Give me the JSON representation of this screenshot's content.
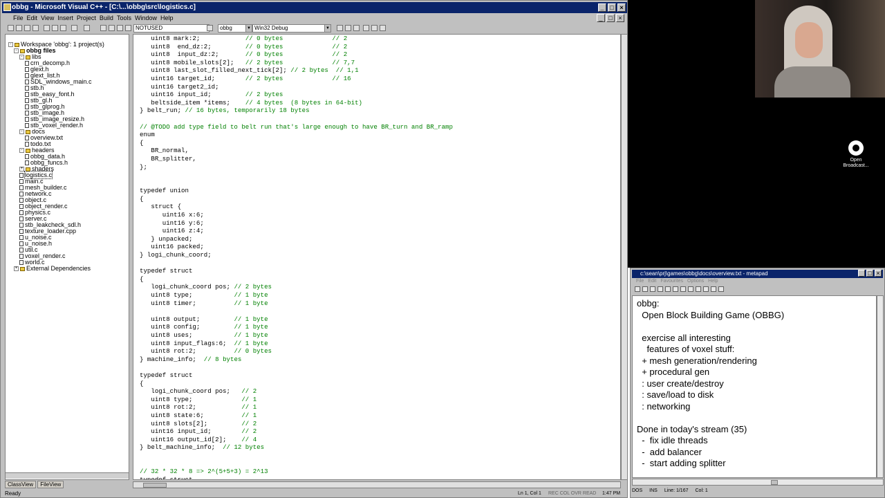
{
  "vc": {
    "title": "obbg - Microsoft Visual C++ - [C:\\...\\obbg\\src\\logistics.c]",
    "menu": [
      "File",
      "Edit",
      "View",
      "Insert",
      "Project",
      "Build",
      "Tools",
      "Window",
      "Help"
    ],
    "toolbar": {
      "config": "NOTUSED",
      "project": "obbg",
      "build": "Win32 Debug"
    },
    "workspace": {
      "title": "Workspace 'obbg': 1 project(s)",
      "items": [
        {
          "t": "obbg files",
          "i": "folder",
          "d": 1,
          "bold": true
        },
        {
          "t": "libs",
          "i": "folder",
          "d": 2
        },
        {
          "t": "crn_decomp.h",
          "i": "doc",
          "d": 3
        },
        {
          "t": "glext.h",
          "i": "doc",
          "d": 3
        },
        {
          "t": "glext_list.h",
          "i": "doc",
          "d": 3
        },
        {
          "t": "SDL_windows_main.c",
          "i": "doc",
          "d": 3
        },
        {
          "t": "stb.h",
          "i": "doc",
          "d": 3
        },
        {
          "t": "stb_easy_font.h",
          "i": "doc",
          "d": 3
        },
        {
          "t": "stb_gl.h",
          "i": "doc",
          "d": 3
        },
        {
          "t": "stb_glprog.h",
          "i": "doc",
          "d": 3
        },
        {
          "t": "stb_image.h",
          "i": "doc",
          "d": 3
        },
        {
          "t": "stb_image_resize.h",
          "i": "doc",
          "d": 3
        },
        {
          "t": "stb_voxel_render.h",
          "i": "doc",
          "d": 3
        },
        {
          "t": "docs",
          "i": "folder",
          "d": 2
        },
        {
          "t": "overview.txt",
          "i": "doc",
          "d": 3
        },
        {
          "t": "todo.txt",
          "i": "doc",
          "d": 3
        },
        {
          "t": "headers",
          "i": "folder",
          "d": 2
        },
        {
          "t": "obbg_data.h",
          "i": "doc",
          "d": 3
        },
        {
          "t": "obbg_funcs.h",
          "i": "doc",
          "d": 3
        },
        {
          "t": "shaders",
          "i": "folder",
          "d": 2
        },
        {
          "t": "logistics.c",
          "i": "doc",
          "d": 2,
          "sel": true
        },
        {
          "t": "main.c",
          "i": "doc",
          "d": 2
        },
        {
          "t": "mesh_builder.c",
          "i": "doc",
          "d": 2
        },
        {
          "t": "network.c",
          "i": "doc",
          "d": 2
        },
        {
          "t": "object.c",
          "i": "doc",
          "d": 2
        },
        {
          "t": "object_render.c",
          "i": "doc",
          "d": 2
        },
        {
          "t": "physics.c",
          "i": "doc",
          "d": 2
        },
        {
          "t": "server.c",
          "i": "doc",
          "d": 2
        },
        {
          "t": "stb_leakcheck_sdl.h",
          "i": "doc",
          "d": 2
        },
        {
          "t": "texture_loader.cpp",
          "i": "doc",
          "d": 2
        },
        {
          "t": "u_noise.c",
          "i": "doc",
          "d": 2
        },
        {
          "t": "u_noise.h",
          "i": "doc",
          "d": 2
        },
        {
          "t": "util.c",
          "i": "doc",
          "d": 2
        },
        {
          "t": "voxel_render.c",
          "i": "doc",
          "d": 2
        },
        {
          "t": "world.c",
          "i": "doc",
          "d": 2
        },
        {
          "t": "External Dependencies",
          "i": "folder",
          "d": 1
        }
      ]
    },
    "tabs": [
      "ClassView",
      "FileView"
    ],
    "code": [
      [
        "   uint8 mark:2;            ",
        "// 0 bytes             // 2"
      ],
      [
        "   uint8  end_dz:2;         ",
        "// 0 bytes             // 2"
      ],
      [
        "   uint8  input_dz:2;       ",
        "// 0 bytes             // 2"
      ],
      [
        "   uint8 mobile_slots[2];   ",
        "// 2 bytes             // 7,7"
      ],
      [
        "   uint8 last_slot_filled_next_tick[2]; ",
        "// 2 bytes  // 1,1"
      ],
      [
        "   uint16 target_id;        ",
        "// 2 bytes             // 16"
      ],
      [
        "   uint16 target2_id;",
        ""
      ],
      [
        "   uint16 input_id;         ",
        "// 2 bytes"
      ],
      [
        "   beltside_item *items;    ",
        "// 4 bytes  (8 bytes in 64-bit)"
      ],
      [
        "} belt_run; ",
        "// 16 bytes, temporarily 18 bytes"
      ],
      [
        "",
        ""
      ],
      [
        "",
        "// @TODO add type field to belt run that's large enough to have BR_turn and BR_ramp"
      ],
      [
        "enum",
        ""
      ],
      [
        "{",
        ""
      ],
      [
        "   BR_normal,",
        ""
      ],
      [
        "   BR_splitter,",
        ""
      ],
      [
        "};",
        ""
      ],
      [
        "",
        ""
      ],
      [
        "",
        ""
      ],
      [
        "typedef union",
        ""
      ],
      [
        "{",
        ""
      ],
      [
        "   struct {",
        ""
      ],
      [
        "      uint16 x:6;",
        ""
      ],
      [
        "      uint16 y:6;",
        ""
      ],
      [
        "      uint16 z:4;",
        ""
      ],
      [
        "   } unpacked;",
        ""
      ],
      [
        "   uint16 packed;",
        ""
      ],
      [
        "} logi_chunk_coord;",
        ""
      ],
      [
        "",
        ""
      ],
      [
        "typedef struct",
        ""
      ],
      [
        "{",
        ""
      ],
      [
        "   logi_chunk_coord pos; ",
        "// 2 bytes"
      ],
      [
        "   uint8 type;           ",
        "// 1 byte"
      ],
      [
        "   uint8 timer;          ",
        "// 1 byte"
      ],
      [
        "",
        ""
      ],
      [
        "   uint8 output;         ",
        "// 1 byte"
      ],
      [
        "   uint8 config;         ",
        "// 1 byte"
      ],
      [
        "   uint8 uses;           ",
        "// 1 byte"
      ],
      [
        "   uint8 input_flags:6;  ",
        "// 1 byte"
      ],
      [
        "   uint8 rot:2;          ",
        "// 0 bytes"
      ],
      [
        "} machine_info;  ",
        "// 8 bytes"
      ],
      [
        "",
        ""
      ],
      [
        "typedef struct",
        ""
      ],
      [
        "{",
        ""
      ],
      [
        "   logi_chunk_coord pos;   ",
        "// 2"
      ],
      [
        "   uint8 type;             ",
        "// 1"
      ],
      [
        "   uint8 rot:2;            ",
        "// 1"
      ],
      [
        "   uint8 state:6;          ",
        "// 1"
      ],
      [
        "   uint8 slots[2];         ",
        "// 2"
      ],
      [
        "   uint16 input_id;        ",
        "// 2"
      ],
      [
        "   uint16 output_id[2];    ",
        "// 4"
      ],
      [
        "} belt_machine_info;  ",
        "// 12 bytes"
      ],
      [
        "",
        ""
      ],
      [
        "",
        ""
      ],
      [
        "",
        "// 32 * 32 * 8 => 2^(5+5+3) = 2^13"
      ],
      [
        "typedef struct",
        ""
      ]
    ],
    "status": {
      "left": "Ready",
      "pos": "Ln 1, Col 1",
      "flags": "REC COL OVR READ",
      "time": "1:47 PM"
    }
  },
  "obs": {
    "label": "Open Broadcast..."
  },
  "notepad": {
    "title": "c:\\sean\\prj\\games\\obbg\\docs\\overview.txt - metapad",
    "menu": [
      "File",
      "Edit",
      "Favourites",
      "Options",
      "Help"
    ],
    "text": "obbg:\n  Open Block Building Game (OBBG)\n\n  exercise all interesting\n    features of voxel stuff:\n  + mesh generation/rendering\n  + procedural gen\n  : user create/destroy\n  : save/load to disk\n  : networking\n\nDone in today's stream (35)\n  -  fix idle threads\n  -  add balancer\n  -  start adding splitter",
    "status": [
      "DOS",
      "INS",
      "Line: 1/167",
      "Col: 1"
    ]
  }
}
